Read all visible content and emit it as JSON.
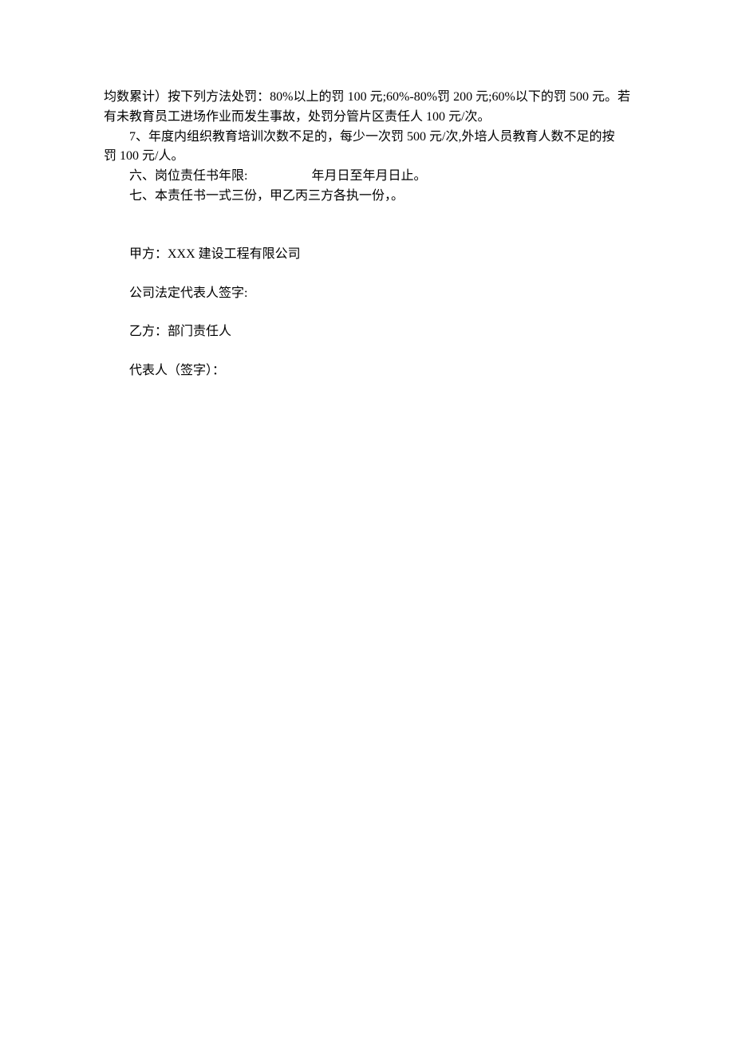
{
  "document": {
    "para_continuation": "均数累计）按下列方法处罚：80%以上的罚 100 元;60%-80%罚 200 元;60%以下的罚 500 元。若有未教育员工进场作业而发生事故，处罚分管片区责任人 100 元/次。",
    "para_item7_line1": "7、年度内组织教育培训次数不足的，每少一次罚 500 元/次,外培人员教育人数不足的按",
    "para_item7_line2": "罚 100 元/人。",
    "para_item6": "六、岗位责任书年限:　　　　　年月日至年月日止。",
    "para_item7_main": "七、本责任书一式三份，甲乙丙三方各执一份，。",
    "signatures": {
      "party_a": "甲方：XXX 建设工程有限公司",
      "party_a_rep": "公司法定代表人签字:",
      "party_b": "乙方：部门责任人",
      "party_b_rep": "代表人（签字）："
    }
  }
}
